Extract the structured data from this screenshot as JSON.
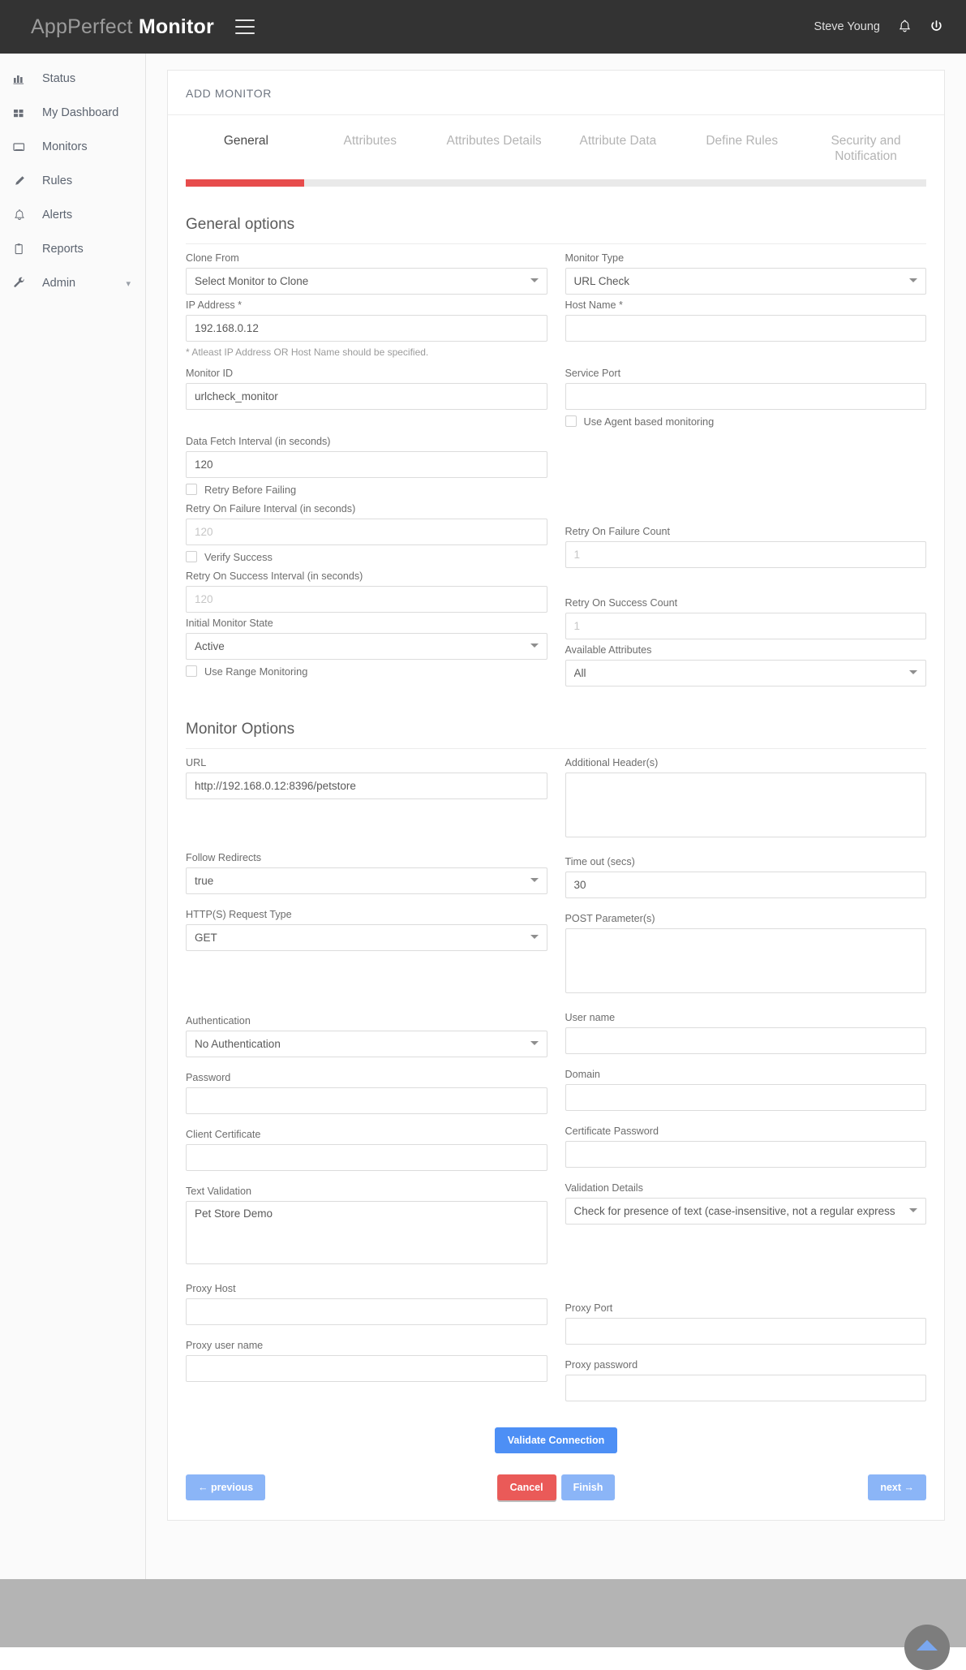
{
  "header": {
    "brand_primary": "AppPerfect",
    "brand_secondary": "Monitor",
    "menu_icon": "hamburger-icon",
    "username": "Steve Young",
    "bell_icon": "bell-icon",
    "power_icon": "power-icon"
  },
  "sidebar": {
    "items": [
      {
        "label": "Status",
        "icon": "bar-chart-icon"
      },
      {
        "label": "My Dashboard",
        "icon": "grid-icon"
      },
      {
        "label": "Monitors",
        "icon": "monitor-icon"
      },
      {
        "label": "Rules",
        "icon": "pencil-icon"
      },
      {
        "label": "Alerts",
        "icon": "bell-icon"
      },
      {
        "label": "Reports",
        "icon": "clipboard-icon"
      },
      {
        "label": "Admin",
        "icon": "wrench-icon",
        "chevron": "⌄"
      }
    ]
  },
  "card": {
    "title": "ADD MONITOR",
    "tabs": [
      {
        "label": "General",
        "active": true
      },
      {
        "label": "Attributes",
        "active": false
      },
      {
        "label": "Attributes Details",
        "active": false
      },
      {
        "label": "Attribute Data",
        "active": false
      },
      {
        "label": "Define Rules",
        "active": false
      },
      {
        "label": "Security and Notification",
        "active": false
      }
    ],
    "progress_percent": 16,
    "progress_color": "#e74c4c"
  },
  "general": {
    "section_title": "General options",
    "clone_from": {
      "label": "Clone From",
      "value": "Select Monitor to Clone"
    },
    "monitor_type": {
      "label": "Monitor Type",
      "value": "URL Check"
    },
    "ip_address": {
      "label": "IP Address *",
      "value": "192.168.0.12"
    },
    "host_name": {
      "label": "Host Name *",
      "value": ""
    },
    "note": "* Atleast IP Address OR Host Name should be specified.",
    "monitor_id": {
      "label": "Monitor ID",
      "value": "urlcheck_monitor"
    },
    "service_port": {
      "label": "Service Port",
      "value": ""
    },
    "use_agent": {
      "label": "Use Agent based monitoring",
      "checked": false
    },
    "data_fetch_interval": {
      "label": "Data Fetch Interval (in seconds)",
      "value": "120"
    },
    "retry_before_failing": {
      "label": "Retry Before Failing",
      "checked": false
    },
    "retry_failure_interval": {
      "label": "Retry On Failure Interval (in seconds)",
      "placeholder": "120",
      "value": ""
    },
    "retry_failure_count": {
      "label": "Retry On Failure Count",
      "placeholder": "1",
      "value": ""
    },
    "verify_success": {
      "label": "Verify Success",
      "checked": false
    },
    "retry_success_interval": {
      "label": "Retry On Success Interval (in seconds)",
      "placeholder": "120",
      "value": ""
    },
    "retry_success_count": {
      "label": "Retry On Success Count",
      "placeholder": "1",
      "value": ""
    },
    "initial_monitor_state": {
      "label": "Initial Monitor State",
      "value": "Active"
    },
    "available_attributes": {
      "label": "Available Attributes",
      "value": "All"
    },
    "use_range_monitoring": {
      "label": "Use Range Monitoring",
      "checked": false
    }
  },
  "monitor_options": {
    "section_title": "Monitor Options",
    "url": {
      "label": "URL",
      "value": "http://192.168.0.12:8396/petstore"
    },
    "additional_headers": {
      "label": "Additional Header(s)",
      "value": ""
    },
    "follow_redirects": {
      "label": "Follow Redirects",
      "value": "true"
    },
    "timeout": {
      "label": "Time out (secs)",
      "value": "30"
    },
    "request_type": {
      "label": "HTTP(S) Request Type",
      "value": "GET"
    },
    "post_parameters": {
      "label": "POST Parameter(s)",
      "value": ""
    },
    "authentication": {
      "label": "Authentication",
      "value": "No Authentication"
    },
    "user_name": {
      "label": "User name",
      "value": ""
    },
    "password": {
      "label": "Password",
      "value": ""
    },
    "domain": {
      "label": "Domain",
      "value": ""
    },
    "client_certificate": {
      "label": "Client Certificate",
      "value": ""
    },
    "certificate_password": {
      "label": "Certificate Password",
      "value": ""
    },
    "text_validation": {
      "label": "Text Validation",
      "value": "Pet Store Demo"
    },
    "validation_details": {
      "label": "Validation Details",
      "value": "Check for presence of text (case-insensitive, not a regular express"
    },
    "proxy_host": {
      "label": "Proxy Host",
      "value": ""
    },
    "proxy_port": {
      "label": "Proxy Port",
      "value": ""
    },
    "proxy_user_name": {
      "label": "Proxy user name",
      "value": ""
    },
    "proxy_password": {
      "label": "Proxy password",
      "value": ""
    }
  },
  "buttons": {
    "validate": "Validate Connection",
    "previous": "← previous",
    "cancel": "Cancel",
    "finish": "Finish",
    "next": "next →"
  },
  "footer": {
    "scroll_top_icon": "chevron-up-icon"
  }
}
